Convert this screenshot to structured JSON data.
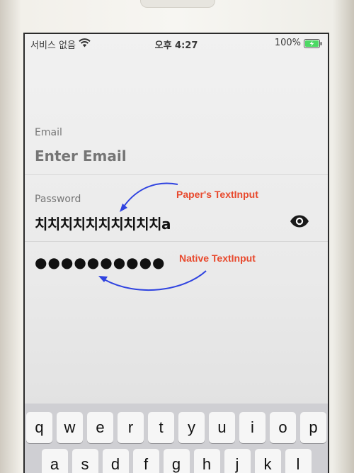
{
  "status_bar": {
    "carrier": "서비스 없음",
    "time": "오후 4:27",
    "battery_percent": "100%",
    "wifi_icon": "wifi-icon",
    "battery_icon": "battery-charging-icon"
  },
  "form": {
    "email": {
      "label": "Email",
      "placeholder": "Enter Email"
    },
    "password": {
      "label": "Password",
      "paper_value": "치치치치치치치치치치a",
      "native_value": "●●●●●●●●●●",
      "visibility_icon": "eye-icon"
    }
  },
  "annotations": {
    "paper": "Paper's TextInput",
    "native": "Native TextInput",
    "color": "#e8492d",
    "arrow_color": "#2f43e0"
  },
  "keyboard": {
    "row1": [
      "q",
      "w",
      "e",
      "r",
      "t",
      "y",
      "u",
      "i",
      "o",
      "p"
    ],
    "row2": [
      "a",
      "s",
      "d",
      "f",
      "g",
      "h",
      "j",
      "k",
      "l"
    ]
  }
}
